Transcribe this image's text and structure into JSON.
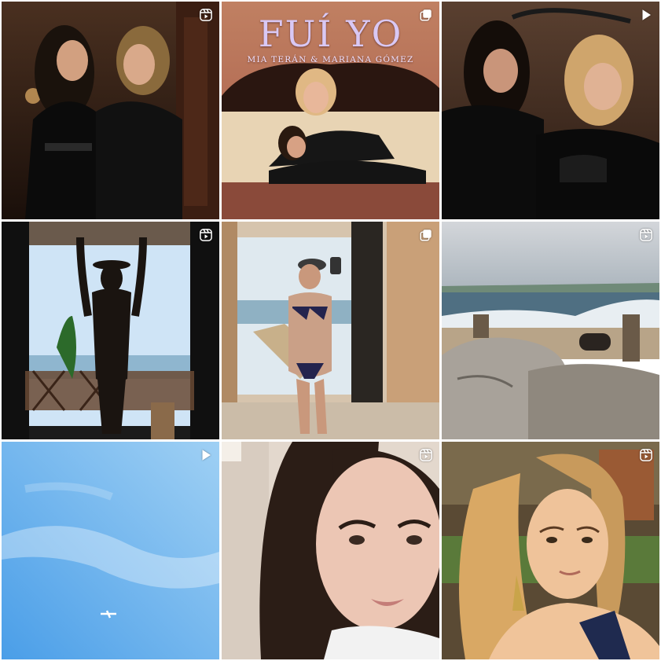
{
  "grid": {
    "posts": [
      {
        "id": "post-1",
        "kind": "reel",
        "badge_icon": "reels-icon",
        "palette": [
          "#3a2418",
          "#0b0b0b",
          "#c89a73"
        ]
      },
      {
        "id": "post-2",
        "kind": "carousel",
        "badge_icon": "carousel-icon",
        "cover_title": "FUÍ YO",
        "cover_subtitle": "MIA TERÁN & MARIANA GÓMEZ",
        "palette": [
          "#b5745a",
          "#e8cfa5",
          "#2b1a14"
        ]
      },
      {
        "id": "post-3",
        "kind": "video",
        "badge_icon": "play-icon",
        "palette": [
          "#3b2a20",
          "#0d0d0d",
          "#d8b38c"
        ]
      },
      {
        "id": "post-4",
        "kind": "reel",
        "badge_icon": "reels-icon",
        "palette": [
          "#1c1c1c",
          "#cfe4f6",
          "#2a2320"
        ]
      },
      {
        "id": "post-5",
        "kind": "carousel",
        "badge_icon": "carousel-icon",
        "palette": [
          "#d9c7b0",
          "#2a2a5a",
          "#c9a58a"
        ]
      },
      {
        "id": "post-6",
        "kind": "reel",
        "badge_icon": "reels-icon",
        "palette": [
          "#c7ced6",
          "#3f5f70",
          "#b7a48c"
        ]
      },
      {
        "id": "post-7",
        "kind": "video",
        "badge_icon": "play-icon",
        "palette": [
          "#9fcdf3",
          "#5aa6ea",
          "#ffffff"
        ]
      },
      {
        "id": "post-8",
        "kind": "reel",
        "badge_icon": "reels-icon",
        "palette": [
          "#e8ddd4",
          "#2a1d17",
          "#f1d1c3"
        ]
      },
      {
        "id": "post-9",
        "kind": "reel",
        "badge_icon": "reels-icon",
        "palette": [
          "#7a5a3a",
          "#f0c79a",
          "#1f2a4f"
        ]
      }
    ]
  }
}
